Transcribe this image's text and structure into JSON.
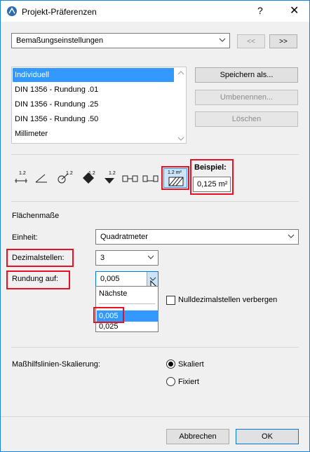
{
  "title": "Projekt-Präferenzen",
  "help_glyph": "?",
  "close_glyph": "✕",
  "preset_combo": {
    "value": "Bemaßungseinstellungen"
  },
  "nav": {
    "prev": "<<",
    "next": ">>"
  },
  "preset_list": [
    {
      "label": "Individuell",
      "selected": true
    },
    {
      "label": "DIN 1356 - Rundung .01",
      "selected": false
    },
    {
      "label": "DIN 1356 - Rundung .25",
      "selected": false
    },
    {
      "label": "DIN 1356 - Rundung .50",
      "selected": false
    },
    {
      "label": "Millimeter",
      "selected": false
    }
  ],
  "buttons": {
    "save_as": "Speichern als...",
    "rename": "Umbenennen...",
    "delete": "Löschen",
    "cancel": "Abbrechen",
    "ok": "OK"
  },
  "toolbar": {
    "tool_label": "1.2",
    "active_tool_label": "1.2 m²"
  },
  "example": {
    "label": "Beispiel:",
    "value": "0,125 m²"
  },
  "section_title": "Flächenmaße",
  "unit": {
    "label": "Einheit:",
    "value": "Quadratmeter"
  },
  "decimals": {
    "label": "Dezimalstellen:",
    "value": "3"
  },
  "rounding": {
    "label": "Rundung auf:",
    "value": "0,005",
    "options": [
      "Nächste",
      "",
      "0,005",
      "0,025"
    ],
    "selected_option": "0,005"
  },
  "hide_zeros": {
    "label": "Nulldezimalstellen verbergen",
    "checked": false
  },
  "scaling": {
    "label": "Maßhilfslinien-Skalierung:",
    "options": [
      {
        "label": "Skaliert",
        "selected": true
      },
      {
        "label": "Fixiert",
        "selected": false
      }
    ]
  },
  "colors": {
    "accent": "#3399ff",
    "highlight": "#e81123",
    "border": "#1883d7"
  }
}
